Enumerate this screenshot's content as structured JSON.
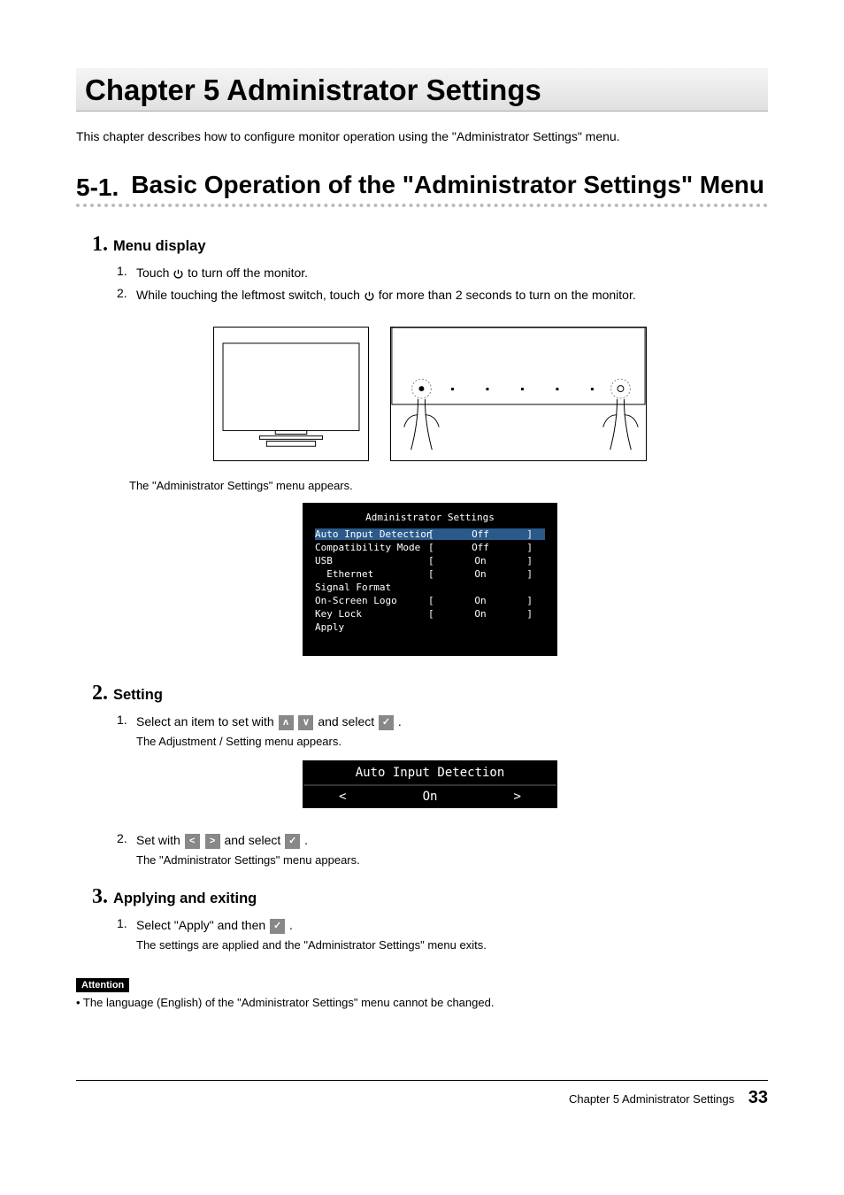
{
  "chapter": {
    "title": "Chapter 5   Administrator Settings",
    "intro": "This chapter describes how to configure monitor operation using the \"Administrator Settings\" menu."
  },
  "section": {
    "number": "5-1.",
    "title": "Basic Operation of the \"Administrator Settings\" Menu"
  },
  "step1": {
    "number": "1.",
    "title": "Menu display",
    "item1_num": "1.",
    "item1_a": "Touch ",
    "item1_b": " to turn off the monitor.",
    "item2_num": "2.",
    "item2_a": "While touching the leftmost switch, touch ",
    "item2_b": " for more than 2 seconds to turn on the monitor.",
    "caption": "The \"Administrator Settings\" menu appears."
  },
  "menu": {
    "title": "Administrator Settings",
    "rows": [
      {
        "label": "Auto Input Detection",
        "value": "Off",
        "brackets": true,
        "hl": true,
        "indent": false
      },
      {
        "label": "Compatibility Mode",
        "value": "Off",
        "brackets": true,
        "hl": false,
        "indent": false
      },
      {
        "label": "USB",
        "value": "On",
        "brackets": true,
        "hl": false,
        "indent": false
      },
      {
        "label": "Ethernet",
        "value": "On",
        "brackets": true,
        "hl": false,
        "indent": true
      },
      {
        "label": "Signal Format",
        "value": "",
        "brackets": false,
        "hl": false,
        "indent": false
      },
      {
        "label": "On-Screen Logo",
        "value": "On",
        "brackets": true,
        "hl": false,
        "indent": false
      },
      {
        "label": "Key Lock",
        "value": "On",
        "brackets": true,
        "hl": false,
        "indent": false
      },
      {
        "label": "Apply",
        "value": "",
        "brackets": false,
        "hl": false,
        "indent": false
      }
    ]
  },
  "step2": {
    "number": "2.",
    "title": "Setting",
    "item1_num": "1.",
    "item1_a": "Select an item to set with ",
    "item1_b": " and select ",
    "item1_c": ".",
    "sub1": "The Adjustment / Setting menu appears.",
    "setting_title": "Auto Input Detection",
    "setting_left": "<",
    "setting_value": "On",
    "setting_right": ">",
    "item2_num": "2.",
    "item2_a": "Set with ",
    "item2_b": " and select ",
    "item2_c": ".",
    "sub2": "The \"Administrator Settings\" menu appears."
  },
  "step3": {
    "number": "3.",
    "title": "Applying and exiting",
    "item1_num": "1.",
    "item1_a": "Select \"Apply\" and then ",
    "item1_b": ".",
    "sub1": "The settings are applied and the \"Administrator Settings\" menu exits."
  },
  "attention": {
    "label": "Attention",
    "text": "•  The language (English) of the \"Administrator Settings\" menu cannot be changed."
  },
  "footer": {
    "text": "Chapter 5 Administrator Settings",
    "page": "33"
  },
  "icons": {
    "up": "ʌ",
    "down": "∨",
    "check": "✓",
    "left": "<",
    "right": ">"
  }
}
